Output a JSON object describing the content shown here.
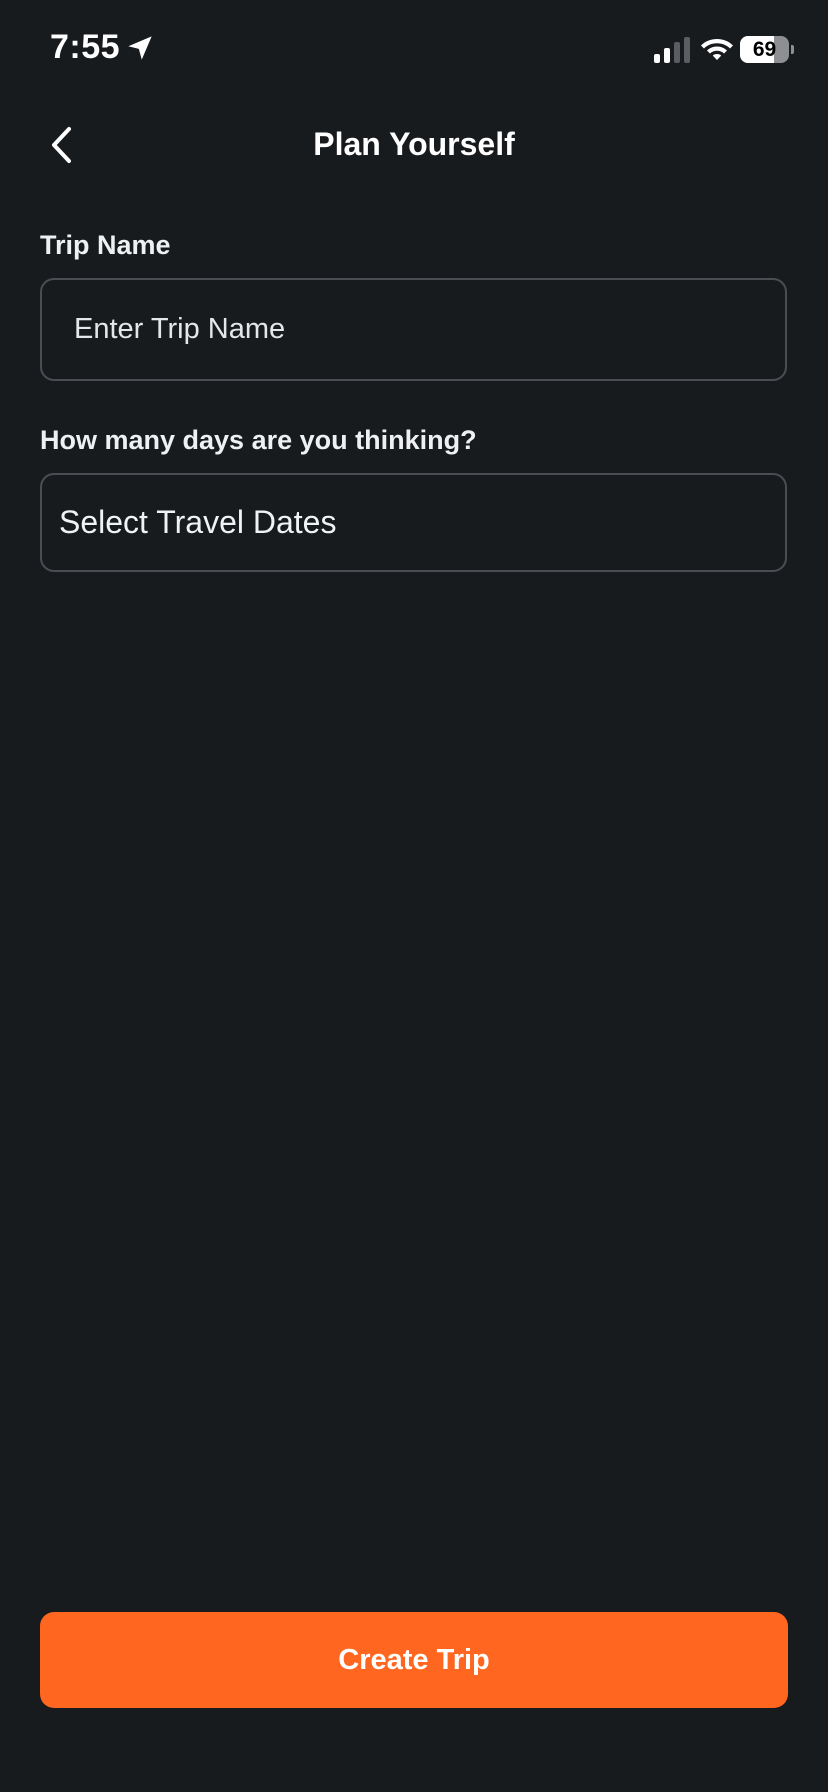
{
  "status_bar": {
    "time": "7:55",
    "battery_level": "69",
    "battery_fraction": 0.69,
    "icons": [
      "location-arrow-icon",
      "cellular-signal-icon",
      "wifi-icon",
      "battery-icon"
    ]
  },
  "header": {
    "title": "Plan Yourself",
    "back_icon": "chevron-left-icon"
  },
  "form": {
    "trip_name": {
      "label": "Trip Name",
      "placeholder": "Enter Trip Name",
      "value": ""
    },
    "travel_dates": {
      "label": "How many days are you thinking?",
      "value": "Select Travel Dates"
    }
  },
  "actions": {
    "create_trip_label": "Create Trip"
  },
  "colors": {
    "background": "#181b1e",
    "accent": "#ff661f",
    "field_border": "#4a4e53",
    "text": "#ffffff"
  }
}
